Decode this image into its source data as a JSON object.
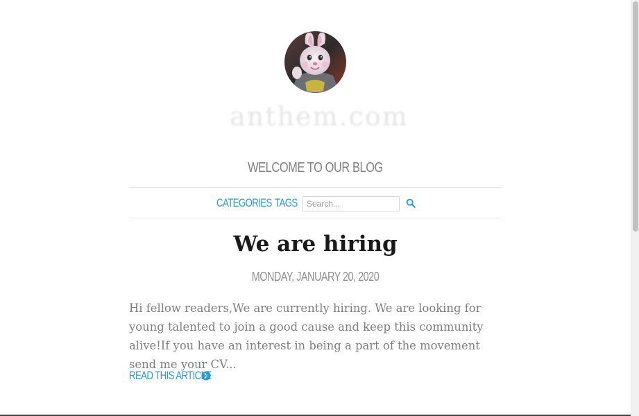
{
  "header": {
    "avatar_alt": "Profile avatar of a person in a rabbit costume",
    "logo_text": "anthem.com",
    "blog_title": "WELCOME TO OUR BLOG"
  },
  "nav": {
    "categories_label": "CATEGORIES",
    "tags_label": "TAGS",
    "search_placeholder": "Search...",
    "search_icon": "search-icon"
  },
  "article": {
    "title": "We are hiring",
    "date": "MONDAY, JANUARY 20, 2020",
    "excerpt": "Hi fellow readers,We are currently hiring. We are looking for young talented to join a good cause and keep this community alive!If you have an interest in being a part of the movement send me your CV...",
    "read_more_label": "READ THIS ARTICLE",
    "read_more_icon": "chevron-circle-right-icon"
  },
  "colors": {
    "accent": "#2b9bd0",
    "title": "#1a1a1a",
    "muted": "#808080",
    "excerpt": "#7e7e7e",
    "divider": "#e5e5e5"
  }
}
